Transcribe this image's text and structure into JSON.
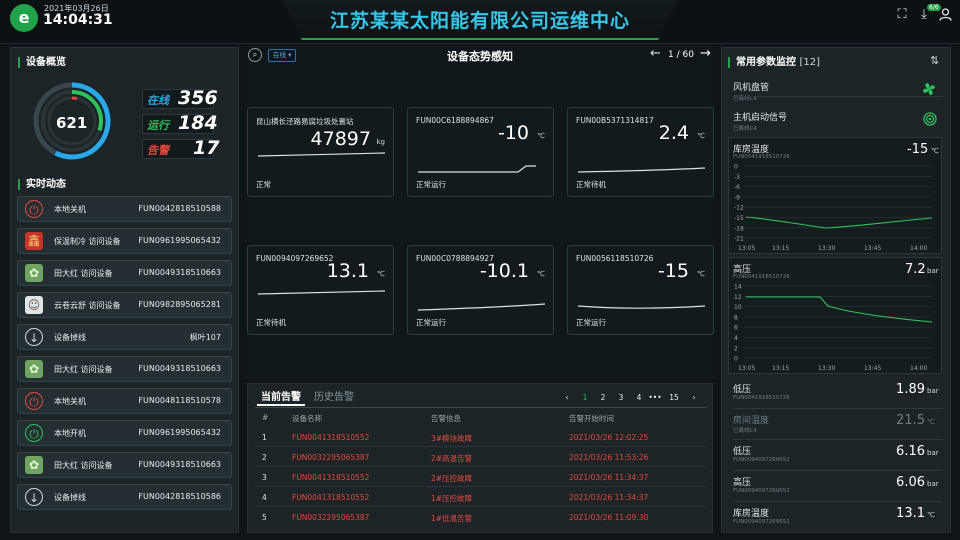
{
  "header": {
    "title": "江苏某某太阳能有限公司运维中心",
    "logo_char": "e",
    "date": "2021年03月26日",
    "time": "14:04:31",
    "badge": "6/6"
  },
  "overview": {
    "title": "设备概览",
    "total": "621",
    "stats": [
      {
        "label": "在线",
        "value": "356",
        "color": "#2aa7e8"
      },
      {
        "label": "运行",
        "value": "184",
        "color": "#2fc25b"
      },
      {
        "label": "告警",
        "value": "17",
        "color": "#e5493c"
      }
    ]
  },
  "dynamics": {
    "title": "实时动态",
    "events": [
      {
        "icon": "power-icon",
        "text": "本地关机",
        "id": "FUN0042818510588"
      },
      {
        "icon": "avatar-red-icon",
        "text": "保温制冷 访问设备",
        "id": "FUN0961995065432"
      },
      {
        "icon": "avatar-green-icon",
        "text": "田大红 访问设备",
        "id": "FUN0049318510663"
      },
      {
        "icon": "avatar-person-icon",
        "text": "云卷云舒 访问设备",
        "id": "FUN0982895065281"
      },
      {
        "icon": "offline-icon",
        "text": "设备掉线",
        "id": "枫叶107"
      },
      {
        "icon": "avatar-green-icon",
        "text": "田大红 访问设备",
        "id": "FUN0049318510663"
      },
      {
        "icon": "power-icon",
        "text": "本地关机",
        "id": "FUN0048118510578"
      },
      {
        "icon": "power-on-icon",
        "text": "本地开机",
        "id": "FUN0961995065432"
      },
      {
        "icon": "avatar-green-icon",
        "text": "田大红 访问设备",
        "id": "FUN0049318510663"
      },
      {
        "icon": "offline-icon",
        "text": "设备掉线",
        "id": "FUN0042818510586"
      }
    ]
  },
  "situation": {
    "title": "设备态势感知",
    "filter": "在线",
    "pager": "1 / 60",
    "cards": [
      {
        "name": "昆山横长泾路易腐垃圾处置站",
        "value": "47897",
        "unit": "kg",
        "status": "正常"
      },
      {
        "name": "FUN00C6188894867",
        "value": "-10",
        "unit": "℃",
        "status": "正常运行"
      },
      {
        "name": "FUN00B5371314817",
        "value": "2.4",
        "unit": "℃",
        "status": "正常待机"
      },
      {
        "name": "FUN0094097269652",
        "value": "13.1",
        "unit": "℃",
        "status": "正常待机"
      },
      {
        "name": "FUN00C0788894927",
        "value": "-10.1",
        "unit": "℃",
        "status": "正常运行"
      },
      {
        "name": "FUN0056118510726",
        "value": "-15",
        "unit": "℃",
        "status": "正常运行"
      }
    ]
  },
  "alarms": {
    "tab_current": "当前告警",
    "tab_history": "历史告警",
    "pages": [
      "1",
      "2",
      "3",
      "4",
      "•••",
      "15"
    ],
    "prev": "‹",
    "next": "›",
    "headers": [
      "#",
      "设备名称",
      "告警信息",
      "告警开始时间"
    ],
    "rows": [
      {
        "no": "1",
        "device": "FUN0041318510552",
        "info": "3#模块故障",
        "time": "2021/03/26 12:02:25"
      },
      {
        "no": "2",
        "device": "FUN0032295065387",
        "info": "2#高温告警",
        "time": "2021/03/26 11:53:26"
      },
      {
        "no": "3",
        "device": "FUN0041318510552",
        "info": "2#压控故障",
        "time": "2021/03/26 11:34:37"
      },
      {
        "no": "4",
        "device": "FUN0041318510552",
        "info": "1#压控故障",
        "time": "2021/03/26 11:34:37"
      },
      {
        "no": "5",
        "device": "FUN0032295065387",
        "info": "1#低温告警",
        "time": "2021/03/26 11:09:30"
      }
    ]
  },
  "params": {
    "title": "常用参数监控",
    "count": "[12]",
    "items": [
      {
        "name": "风机盘管",
        "sub": "已离线C4",
        "kind": "fan"
      },
      {
        "name": "主机启动信号",
        "sub": "已离线C4",
        "kind": "signal"
      }
    ],
    "chart1": {
      "name": "库房温度",
      "sub": "FUN0041918510726",
      "value": "-15",
      "unit": "℃",
      "yticks": [
        "0",
        "-3",
        "-6",
        "-9",
        "-12",
        "-15",
        "-18",
        "-21"
      ],
      "xticks": [
        "13:05",
        "13:15",
        "13:30",
        "13:45",
        "14:00"
      ]
    },
    "chart2": {
      "name": "高压",
      "sub": "FUN0041918510726",
      "value": "7.2",
      "unit": "bar",
      "yticks": [
        "14",
        "12",
        "10",
        "8",
        "6",
        "4",
        "2",
        "0"
      ],
      "xticks": [
        "13:05",
        "13:15",
        "13:30",
        "13:45",
        "14:00"
      ]
    },
    "list": [
      {
        "name": "低压",
        "sub": "FUN0041918510726",
        "value": "1.89",
        "unit": "bar",
        "dim": false
      },
      {
        "name": "房间温度",
        "sub": "已离线C4",
        "value": "21.5",
        "unit": "℃",
        "dim": true
      },
      {
        "name": "低压",
        "sub": "FUN0094097269652",
        "value": "6.16",
        "unit": "bar",
        "dim": false
      },
      {
        "name": "高压",
        "sub": "FUN0094097269652",
        "value": "6.06",
        "unit": "bar",
        "dim": false
      },
      {
        "name": "库房温度",
        "sub": "FUN0094097269652",
        "value": "13.1",
        "unit": "℃",
        "dim": false
      }
    ]
  }
}
